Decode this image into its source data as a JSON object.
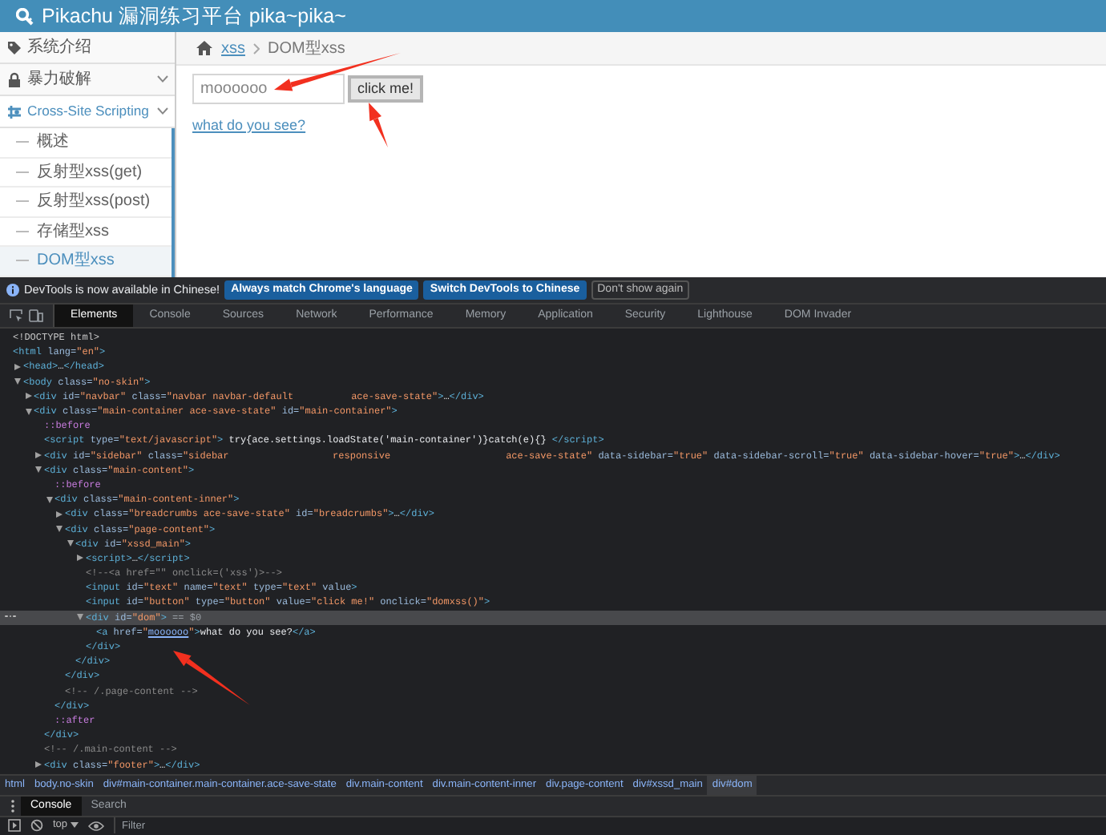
{
  "page": {
    "title": "Pikachu 漏洞练习平台 pika~pika~",
    "sidebar": [
      {
        "label": "系统介绍",
        "selected": false,
        "kind": "link"
      },
      {
        "label": "暴力破解",
        "selected": false,
        "kind": "menu"
      },
      {
        "label": "Cross-Site Scripting",
        "selected": true,
        "kind": "menu",
        "children": [
          {
            "label": "概述",
            "selected": false
          },
          {
            "label": "反射型xss(get)",
            "selected": false
          },
          {
            "label": "反射型xss(post)",
            "selected": false
          },
          {
            "label": "存储型xss",
            "selected": false
          },
          {
            "label": "DOM型xss",
            "selected": true
          }
        ]
      }
    ],
    "breadcrumbs": [
      {
        "label": "xss",
        "kind": "link"
      },
      {
        "label": "DOM型xss",
        "kind": "current"
      }
    ],
    "input": {
      "value": "moooooo"
    },
    "button": "click me!",
    "result_link": "what do you see?"
  },
  "devtools": {
    "notice": {
      "text": "DevTools is now available in Chinese!",
      "buttons": [
        {
          "label": "Always match Chrome's language",
          "kind": "primary"
        },
        {
          "label": "Switch DevTools to Chinese",
          "kind": "primary"
        },
        {
          "label": "Don't show again",
          "kind": "plain"
        }
      ]
    },
    "tabs": [
      {
        "label": "Elements",
        "selected": true
      },
      {
        "label": "Console",
        "selected": false
      },
      {
        "label": "Sources",
        "selected": false
      },
      {
        "label": "Network",
        "selected": false
      },
      {
        "label": "Performance",
        "selected": false
      },
      {
        "label": "Memory",
        "selected": false
      },
      {
        "label": "Application",
        "selected": false
      },
      {
        "label": "Security",
        "selected": false
      },
      {
        "label": "Lighthouse",
        "selected": false
      },
      {
        "label": "DOM Invader",
        "selected": false
      }
    ],
    "dom_tree": [
      {
        "selected": false,
        "tokens": [
          {
            "kind": "doctype",
            "text": "<!DOCTYPE html>"
          }
        ]
      },
      {
        "selected": false,
        "tokens": [
          {
            "kind": "tag",
            "text": "<html"
          },
          {
            "kind": "attr",
            "text": " lang="
          },
          {
            "kind": "value",
            "text": "\"en\""
          },
          {
            "kind": "tag",
            "text": ">"
          }
        ],
        "children": [
          {
            "selected": false,
            "expanded": false,
            "tokens": [
              {
                "kind": "tag",
                "text": "<head>"
              },
              {
                "kind": "text",
                "text": "…"
              },
              {
                "kind": "tag",
                "text": "</head>"
              }
            ]
          },
          {
            "selected": false,
            "expanded": true,
            "tokens": [
              {
                "kind": "tag",
                "text": "<body"
              },
              {
                "kind": "attr",
                "text": " class="
              },
              {
                "kind": "value",
                "text": "\"no-skin\""
              },
              {
                "kind": "tag",
                "text": ">"
              }
            ],
            "children": [
              {
                "selected": false,
                "expanded": false,
                "tokens": [
                  {
                    "kind": "tag",
                    "text": "<div"
                  },
                  {
                    "kind": "attr",
                    "text": " id="
                  },
                  {
                    "kind": "value",
                    "text": "\"navbar\""
                  },
                  {
                    "kind": "attr",
                    "text": " class="
                  },
                  {
                    "kind": "value",
                    "text": "\"navbar navbar-default          ace-save-state\""
                  },
                  {
                    "kind": "tag",
                    "text": ">"
                  },
                  {
                    "kind": "text",
                    "text": "…"
                  },
                  {
                    "kind": "tag",
                    "text": "</div>"
                  }
                ]
              },
              {
                "selected": false,
                "expanded": true,
                "tokens": [
                  {
                    "kind": "tag",
                    "text": "<div"
                  },
                  {
                    "kind": "attr",
                    "text": " class="
                  },
                  {
                    "kind": "value",
                    "text": "\"main-container ace-save-state\""
                  },
                  {
                    "kind": "attr",
                    "text": " id="
                  },
                  {
                    "kind": "value",
                    "text": "\"main-container\""
                  },
                  {
                    "kind": "tag",
                    "text": ">"
                  }
                ],
                "children": [
                  {
                    "selected": false,
                    "tokens": [
                      {
                        "kind": "pseudo",
                        "text": "::before"
                      }
                    ]
                  },
                  {
                    "selected": false,
                    "tokens": [
                      {
                        "kind": "tag",
                        "text": "<script"
                      },
                      {
                        "kind": "attr",
                        "text": " type="
                      },
                      {
                        "kind": "value",
                        "text": "\"text/javascript\""
                      },
                      {
                        "kind": "tag",
                        "text": ">"
                      },
                      {
                        "kind": "text",
                        "text": " try{ace.settings.loadState('main-container')}catch(e){} "
                      },
                      {
                        "kind": "tag",
                        "text": "</script>"
                      }
                    ]
                  },
                  {
                    "selected": false,
                    "expanded": false,
                    "tokens": [
                      {
                        "kind": "tag",
                        "text": "<div"
                      },
                      {
                        "kind": "attr",
                        "text": " id="
                      },
                      {
                        "kind": "value",
                        "text": "\"sidebar\""
                      },
                      {
                        "kind": "attr",
                        "text": " class="
                      },
                      {
                        "kind": "value",
                        "text": "\"sidebar                  responsive                    ace-save-state\""
                      },
                      {
                        "kind": "attr",
                        "text": " data-sidebar="
                      },
                      {
                        "kind": "value",
                        "text": "\"true\""
                      },
                      {
                        "kind": "attr",
                        "text": " data-sidebar-scroll="
                      },
                      {
                        "kind": "value",
                        "text": "\"true\""
                      },
                      {
                        "kind": "attr",
                        "text": " data-sidebar-hover="
                      },
                      {
                        "kind": "value",
                        "text": "\"true\""
                      },
                      {
                        "kind": "tag",
                        "text": ">"
                      },
                      {
                        "kind": "text",
                        "text": "…"
                      },
                      {
                        "kind": "tag",
                        "text": "</div>"
                      }
                    ]
                  },
                  {
                    "selected": false,
                    "expanded": true,
                    "tokens": [
                      {
                        "kind": "tag",
                        "text": "<div"
                      },
                      {
                        "kind": "attr",
                        "text": " class="
                      },
                      {
                        "kind": "value",
                        "text": "\"main-content\""
                      },
                      {
                        "kind": "tag",
                        "text": ">"
                      }
                    ],
                    "children": [
                      {
                        "selected": false,
                        "tokens": [
                          {
                            "kind": "pseudo",
                            "text": "::before"
                          }
                        ]
                      },
                      {
                        "selected": false,
                        "expanded": true,
                        "tokens": [
                          {
                            "kind": "tag",
                            "text": "<div"
                          },
                          {
                            "kind": "attr",
                            "text": " class="
                          },
                          {
                            "kind": "value",
                            "text": "\"main-content-inner\""
                          },
                          {
                            "kind": "tag",
                            "text": ">"
                          }
                        ],
                        "children": [
                          {
                            "selected": false,
                            "expanded": false,
                            "tokens": [
                              {
                                "kind": "tag",
                                "text": "<div"
                              },
                              {
                                "kind": "attr",
                                "text": " class="
                              },
                              {
                                "kind": "value",
                                "text": "\"breadcrumbs ace-save-state\""
                              },
                              {
                                "kind": "attr",
                                "text": " id="
                              },
                              {
                                "kind": "value",
                                "text": "\"breadcrumbs\""
                              },
                              {
                                "kind": "tag",
                                "text": ">"
                              },
                              {
                                "kind": "text",
                                "text": "…"
                              },
                              {
                                "kind": "tag",
                                "text": "</div>"
                              }
                            ]
                          },
                          {
                            "selected": false,
                            "expanded": true,
                            "tokens": [
                              {
                                "kind": "tag",
                                "text": "<div"
                              },
                              {
                                "kind": "attr",
                                "text": " class="
                              },
                              {
                                "kind": "value",
                                "text": "\"page-content\""
                              },
                              {
                                "kind": "tag",
                                "text": ">"
                              }
                            ],
                            "children": [
                              {
                                "selected": false,
                                "expanded": true,
                                "tokens": [
                                  {
                                    "kind": "tag",
                                    "text": "<div"
                                  },
                                  {
                                    "kind": "attr",
                                    "text": " id="
                                  },
                                  {
                                    "kind": "value",
                                    "text": "\"xssd_main\""
                                  },
                                  {
                                    "kind": "tag",
                                    "text": ">"
                                  }
                                ],
                                "children": [
                                  {
                                    "selected": false,
                                    "expanded": false,
                                    "tokens": [
                                      {
                                        "kind": "tag",
                                        "text": "<script>"
                                      },
                                      {
                                        "kind": "text",
                                        "text": "…"
                                      },
                                      {
                                        "kind": "tag",
                                        "text": "</script>"
                                      }
                                    ]
                                  },
                                  {
                                    "selected": false,
                                    "tokens": [
                                      {
                                        "kind": "comment",
                                        "text": "<!--<a href=\"\" onclick=('xss')>-->"
                                      }
                                    ]
                                  },
                                  {
                                    "selected": false,
                                    "tokens": [
                                      {
                                        "kind": "tag",
                                        "text": "<input"
                                      },
                                      {
                                        "kind": "attr",
                                        "text": " id="
                                      },
                                      {
                                        "kind": "value",
                                        "text": "\"text\""
                                      },
                                      {
                                        "kind": "attr",
                                        "text": " name="
                                      },
                                      {
                                        "kind": "value",
                                        "text": "\"text\""
                                      },
                                      {
                                        "kind": "attr",
                                        "text": " type="
                                      },
                                      {
                                        "kind": "value",
                                        "text": "\"text\""
                                      },
                                      {
                                        "kind": "attr",
                                        "text": " value"
                                      },
                                      {
                                        "kind": "tag",
                                        "text": ">"
                                      }
                                    ]
                                  },
                                  {
                                    "selected": false,
                                    "tokens": [
                                      {
                                        "kind": "tag",
                                        "text": "<input"
                                      },
                                      {
                                        "kind": "attr",
                                        "text": " id="
                                      },
                                      {
                                        "kind": "value",
                                        "text": "\"button\""
                                      },
                                      {
                                        "kind": "attr",
                                        "text": " type="
                                      },
                                      {
                                        "kind": "value",
                                        "text": "\"button\""
                                      },
                                      {
                                        "kind": "attr",
                                        "text": " value="
                                      },
                                      {
                                        "kind": "value",
                                        "text": "\"click me!\""
                                      },
                                      {
                                        "kind": "attr",
                                        "text": " onclick="
                                      },
                                      {
                                        "kind": "value",
                                        "text": "\"domxss()\""
                                      },
                                      {
                                        "kind": "tag",
                                        "text": ">"
                                      }
                                    ]
                                  },
                                  {
                                    "selected": true,
                                    "expanded": true,
                                    "tokens": [
                                      {
                                        "kind": "tag",
                                        "text": "<div"
                                      },
                                      {
                                        "kind": "attr",
                                        "text": " id="
                                      },
                                      {
                                        "kind": "value",
                                        "text": "\"dom\""
                                      },
                                      {
                                        "kind": "tag",
                                        "text": ">"
                                      },
                                      {
                                        "kind": "ref",
                                        "text": " == $0"
                                      }
                                    ],
                                    "children": [
                                      {
                                        "selected": false,
                                        "tokens": [
                                          {
                                            "kind": "tag",
                                            "text": "<a"
                                          },
                                          {
                                            "kind": "attr",
                                            "text": " href="
                                          },
                                          {
                                            "kind": "value",
                                            "text": "\""
                                          },
                                          {
                                            "kind": "link",
                                            "text": "moooooo"
                                          },
                                          {
                                            "kind": "value",
                                            "text": "\""
                                          },
                                          {
                                            "kind": "tag",
                                            "text": ">"
                                          },
                                          {
                                            "kind": "text",
                                            "text": "what do you see?"
                                          },
                                          {
                                            "kind": "tag",
                                            "text": "</a>"
                                          }
                                        ]
                                      }
                                    ],
                                    "close": [
                                      {
                                        "kind": "tag",
                                        "text": "</div>"
                                      }
                                    ]
                                  }
                                ],
                                "close": [
                                  {
                                    "kind": "tag",
                                    "text": "</div>"
                                  }
                                ]
                              }
                            ],
                            "close": [
                              {
                                "kind": "tag",
                                "text": "</div>"
                              }
                            ]
                          },
                          {
                            "selected": false,
                            "tokens": [
                              {
                                "kind": "comment",
                                "text": "<!-- /.page-content -->"
                              }
                            ]
                          }
                        ],
                        "close": [
                          {
                            "kind": "tag",
                            "text": "</div>"
                          }
                        ]
                      },
                      {
                        "selected": false,
                        "tokens": [
                          {
                            "kind": "pseudo",
                            "text": "::after"
                          }
                        ]
                      }
                    ],
                    "close": [
                      {
                        "kind": "tag",
                        "text": "</div>"
                      }
                    ]
                  },
                  {
                    "selected": false,
                    "tokens": [
                      {
                        "kind": "comment",
                        "text": "<!-- /.main-content -->"
                      }
                    ]
                  },
                  {
                    "selected": false,
                    "expanded": false,
                    "tokens": [
                      {
                        "kind": "tag",
                        "text": "<div"
                      },
                      {
                        "kind": "attr",
                        "text": " class="
                      },
                      {
                        "kind": "value",
                        "text": "\"footer\""
                      },
                      {
                        "kind": "tag",
                        "text": ">"
                      },
                      {
                        "kind": "text",
                        "text": "…"
                      },
                      {
                        "kind": "tag",
                        "text": "</div>"
                      }
                    ]
                  }
                ]
              }
            ]
          }
        ]
      }
    ],
    "crumbs": [
      {
        "label": "html",
        "selected": false
      },
      {
        "label": "body.no-skin",
        "selected": false
      },
      {
        "label": "div#main-container.main-container.ace-save-state",
        "selected": false
      },
      {
        "label": "div.main-content",
        "selected": false
      },
      {
        "label": "div.main-content-inner",
        "selected": false
      },
      {
        "label": "div.page-content",
        "selected": false
      },
      {
        "label": "div#xssd_main",
        "selected": false
      },
      {
        "label": "div#dom",
        "selected": true
      }
    ],
    "drawer_tabs": [
      {
        "label": "Console",
        "selected": true
      },
      {
        "label": "Search",
        "selected": false
      }
    ],
    "console_toolbar": {
      "context": "top",
      "filter_placeholder": "Filter"
    }
  }
}
